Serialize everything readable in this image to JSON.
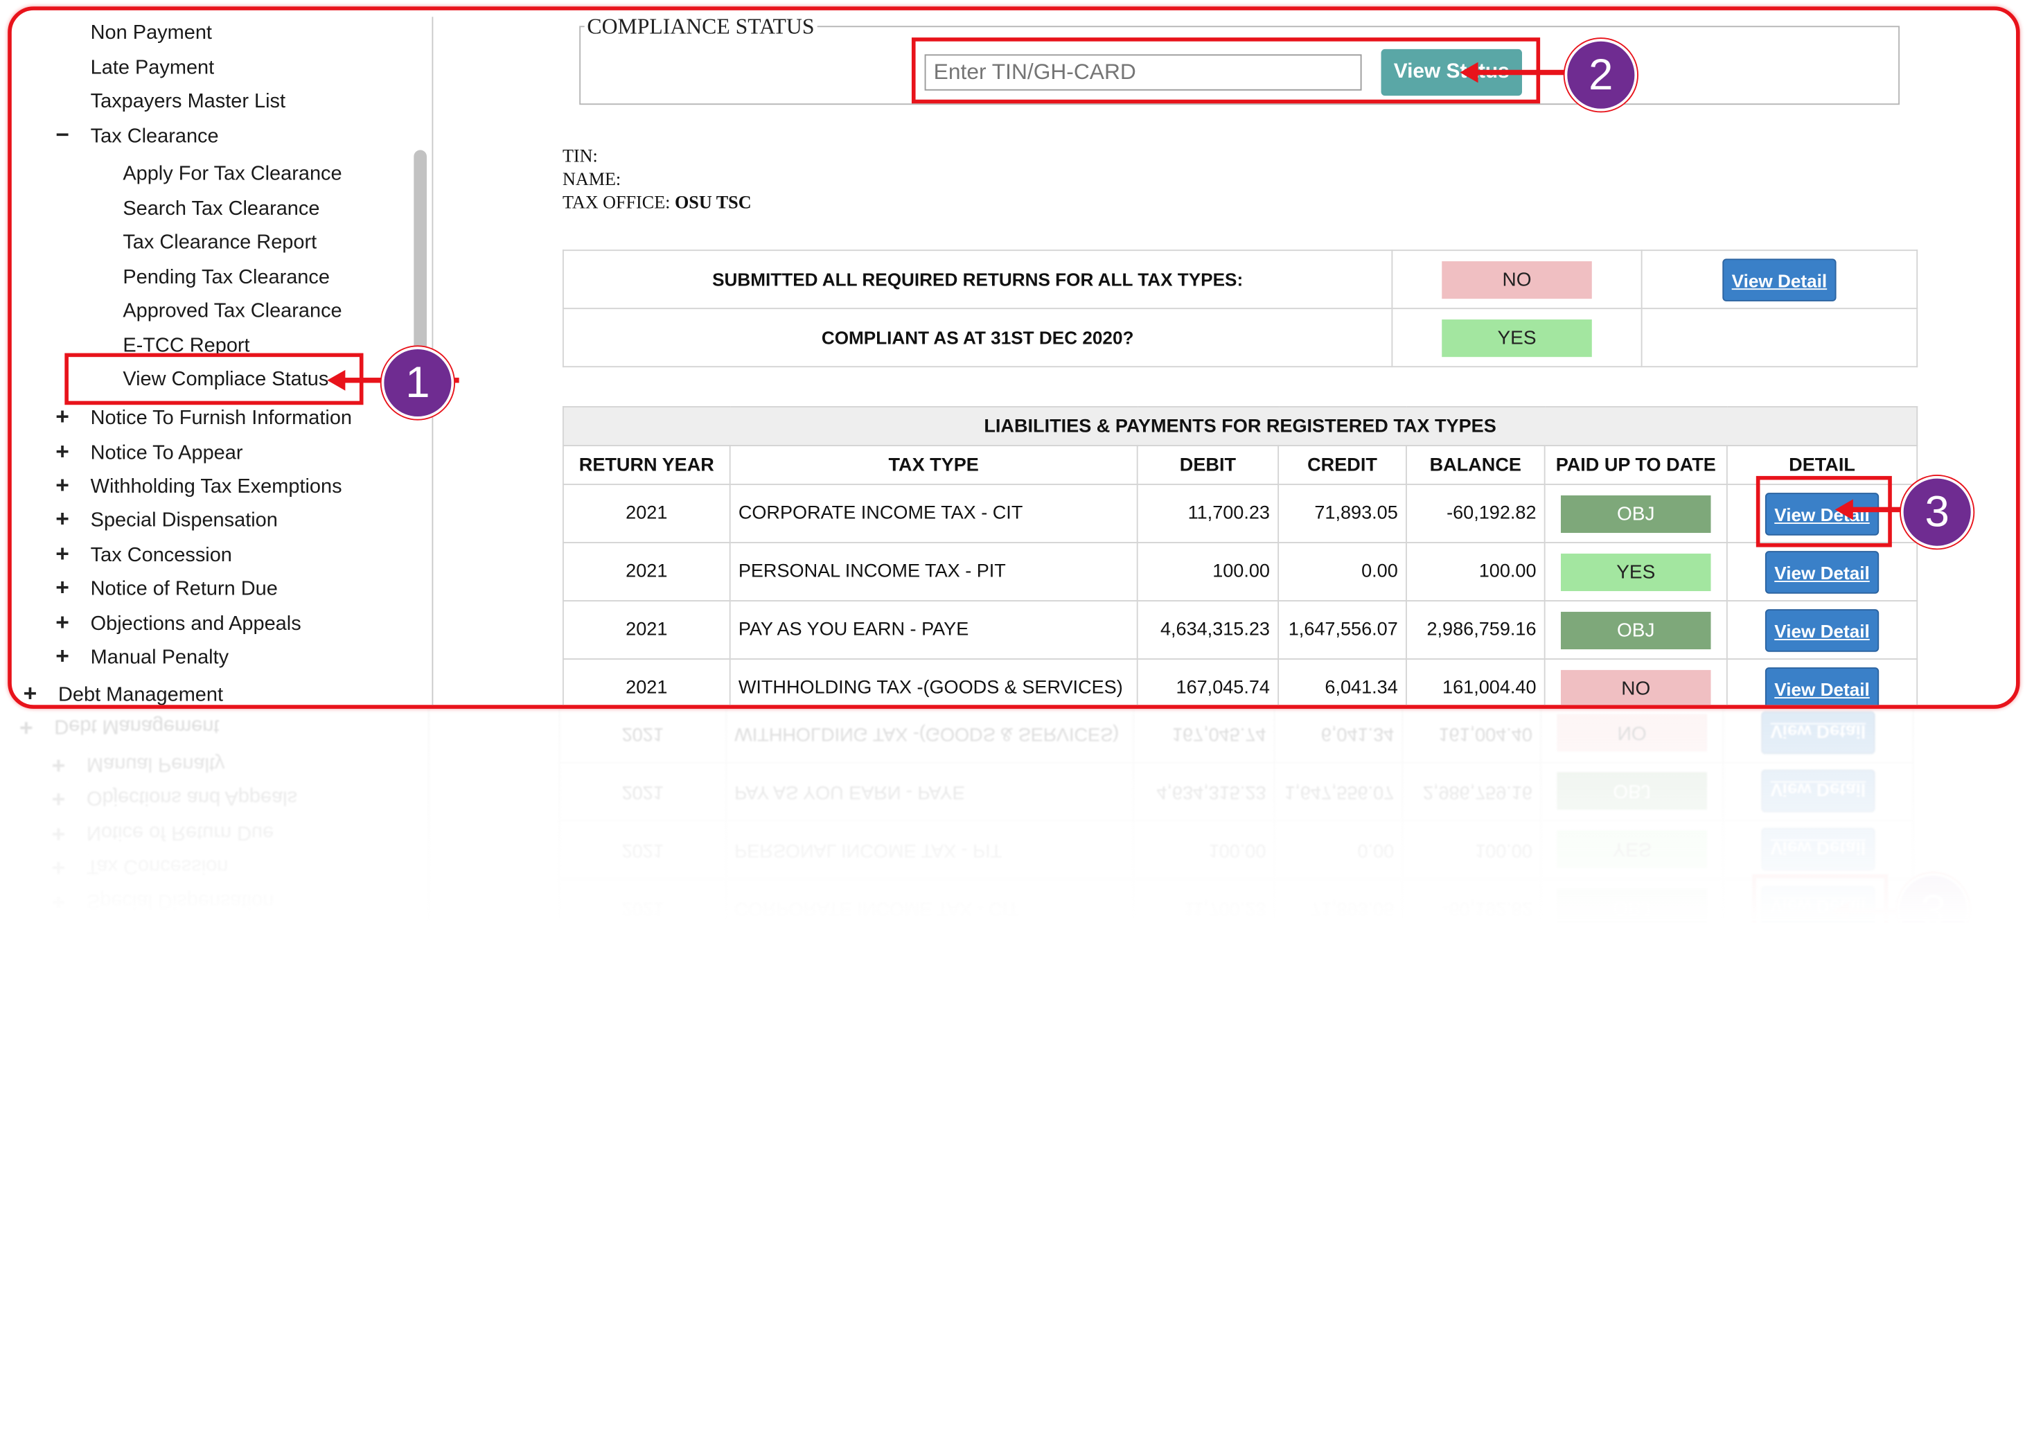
{
  "sidebar": {
    "items_top": [
      "Non Payment",
      "Late Payment",
      "Taxpayers Master List"
    ],
    "tax_clearance": {
      "label": "Tax Clearance",
      "toggle": "−",
      "children": [
        "Apply For Tax Clearance",
        "Search Tax Clearance",
        "Tax Clearance Report",
        "Pending Tax Clearance",
        "Approved Tax Clearance",
        "E-TCC Report",
        "View Compliace Status"
      ]
    },
    "collapsed": [
      "Notice To Furnish Information",
      "Notice To Appear",
      "Withholding Tax Exemptions",
      "Special Dispensation",
      "Tax Concession",
      "Notice of Return Due",
      "Objections and Appeals",
      "Manual Penalty"
    ],
    "debt": "Debt Management",
    "plus": "+"
  },
  "compliance": {
    "legend": "COMPLIANCE STATUS",
    "placeholder": "Enter TIN/GH-CARD",
    "button": "View Status"
  },
  "info": {
    "tin_label": "TIN:",
    "name_label": "NAME:",
    "office_label": "TAX OFFICE:",
    "office_value": "OSU TSC"
  },
  "summary": [
    {
      "question": "SUBMITTED ALL REQUIRED RETURNS FOR ALL TAX TYPES:",
      "answer": "NO",
      "action": "View Detail"
    },
    {
      "question": "COMPLIANT AS AT 31ST DEC 2020?",
      "answer": "YES",
      "action": ""
    }
  ],
  "liabilities": {
    "caption": "LIABILITIES & PAYMENTS FOR REGISTERED TAX TYPES",
    "headers": [
      "RETURN YEAR",
      "TAX TYPE",
      "DEBIT",
      "CREDIT",
      "BALANCE",
      "PAID UP TO DATE",
      "DETAIL"
    ],
    "rows": [
      {
        "year": "2021",
        "type": "CORPORATE INCOME TAX - CIT",
        "debit": "11,700.23",
        "credit": "71,893.05",
        "balance": "-60,192.82",
        "paid": "OBJ",
        "detail": "View Detail"
      },
      {
        "year": "2021",
        "type": "PERSONAL INCOME TAX - PIT",
        "debit": "100.00",
        "credit": "0.00",
        "balance": "100.00",
        "paid": "YES",
        "detail": "View Detail"
      },
      {
        "year": "2021",
        "type": "PAY AS YOU EARN - PAYE",
        "debit": "4,634,315.23",
        "credit": "1,647,556.07",
        "balance": "2,986,759.16",
        "paid": "OBJ",
        "detail": "View Detail"
      },
      {
        "year": "2021",
        "type": "WITHHOLDING TAX -(GOODS & SERVICES)",
        "debit": "167,045.74",
        "credit": "6,041.34",
        "balance": "161,004.40",
        "paid": "NO",
        "detail": "View Detail"
      }
    ]
  },
  "annotations": {
    "step1": "1",
    "step2": "2",
    "step3": "3",
    "color": "#e8131b",
    "badge_color": "#6f2c91"
  }
}
